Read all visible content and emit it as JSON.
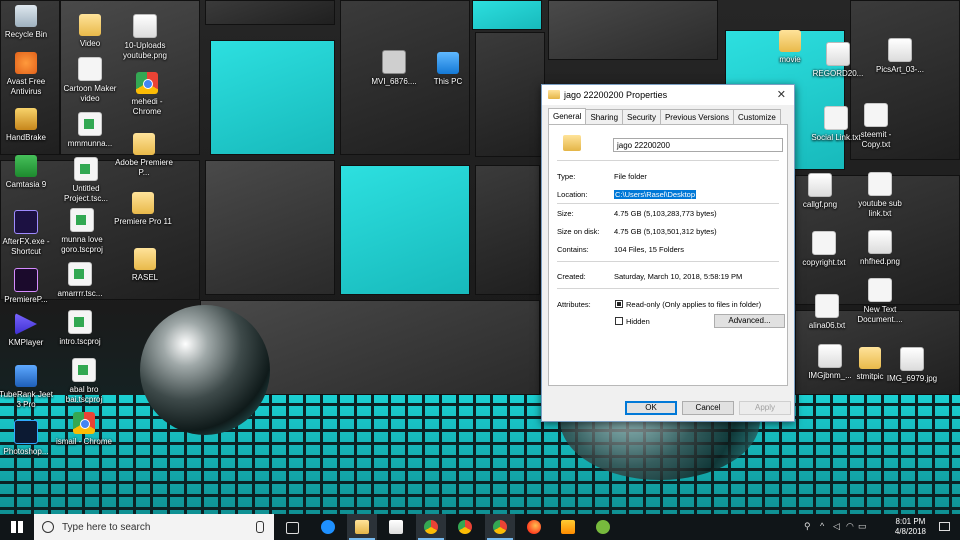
{
  "desktop": {
    "icons": [
      {
        "label": "Recycle Bin"
      },
      {
        "label": "Avast Free Antivirus"
      },
      {
        "label": "HandBrake"
      },
      {
        "label": "Camtasia 9"
      },
      {
        "label": "AfterFX.exe - Shortcut"
      },
      {
        "label": "PremiereP..."
      },
      {
        "label": "KMPlayer"
      },
      {
        "label": "TubeRank Jeet 3 Pro"
      },
      {
        "label": "Photoshop..."
      },
      {
        "label": "Video"
      },
      {
        "label": "Cartoon Maker video"
      },
      {
        "label": "mmmunna..."
      },
      {
        "label": "Untitled Project.tsc..."
      },
      {
        "label": "munna love goro.tscproj"
      },
      {
        "label": "amarrrr.tsc..."
      },
      {
        "label": "intro.tscproj"
      },
      {
        "label": "abal bro bai.tscproj"
      },
      {
        "label": "ismail - Chrome"
      },
      {
        "label": "10-Uploads youtube.png"
      },
      {
        "label": "mehedi - Chrome"
      },
      {
        "label": "Adobe Premiere P..."
      },
      {
        "label": "Premiere Pro 11"
      },
      {
        "label": "RASEL"
      },
      {
        "label": "MVI_6876...."
      },
      {
        "label": "This PC"
      },
      {
        "label": "movie"
      },
      {
        "label": "REGORD20..."
      },
      {
        "label": "PicsArt_03-..."
      },
      {
        "label": "Social Link.txt"
      },
      {
        "label": "steemit - Copy.txt"
      },
      {
        "label": "callgf.png"
      },
      {
        "label": "youtube sub link.txt"
      },
      {
        "label": "copyright.txt"
      },
      {
        "label": "nhfhed.png"
      },
      {
        "label": "alina06.txt"
      },
      {
        "label": "New Text Document...."
      },
      {
        "label": "IMGjbnm_..."
      },
      {
        "label": "stmitpic"
      },
      {
        "label": "IMG_6979.jpg"
      }
    ]
  },
  "dialog": {
    "title": "jago  22200200 Properties",
    "close_glyph": "✕",
    "tabs": [
      "General",
      "Sharing",
      "Security",
      "Previous Versions",
      "Customize"
    ],
    "active_tab": "General",
    "name": "jago  22200200",
    "fields": {
      "type_label": "Type:",
      "type_value": "File folder",
      "location_label": "Location:",
      "location_value": "C:\\Users\\Rasel\\Desktop",
      "size_label": "Size:",
      "size_value": "4.75 GB (5,103,283,773 bytes)",
      "size_on_disk_label": "Size on disk:",
      "size_on_disk_value": "4.75 GB (5,103,501,312 bytes)",
      "contains_label": "Contains:",
      "contains_value": "104 Files, 15 Folders",
      "created_label": "Created:",
      "created_value": "Saturday, March 10, 2018, 5:58:19 PM",
      "attributes_label": "Attributes:",
      "readonly_label": "Read-only (Only applies to files in folder)",
      "hidden_label": "Hidden",
      "advanced_label": "Advanced..."
    },
    "buttons": {
      "ok": "OK",
      "cancel": "Cancel",
      "apply": "Apply"
    }
  },
  "taskbar": {
    "search_placeholder": "Type here to search",
    "time": "8:01 PM",
    "date": "4/8/2018"
  },
  "colors": {
    "accent": "#0078d7",
    "wallpaper_teal": "#1fd5d6"
  }
}
